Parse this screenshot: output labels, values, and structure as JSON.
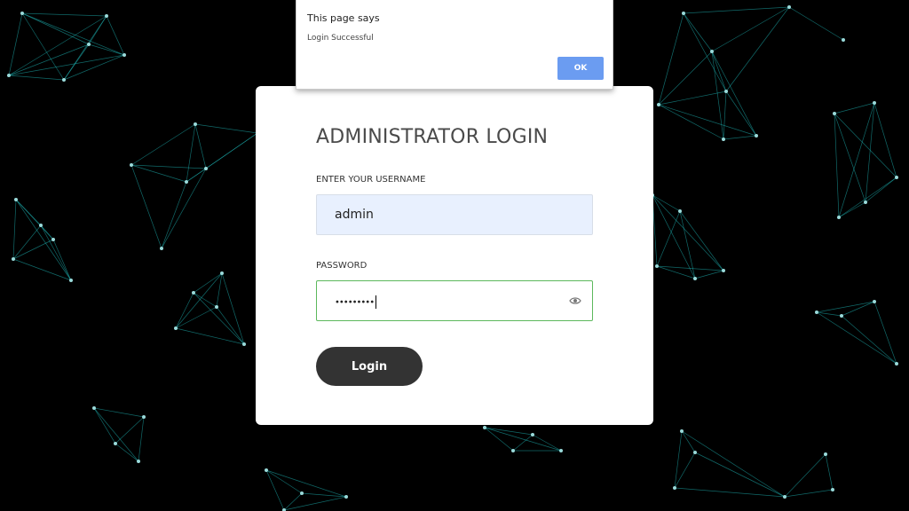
{
  "dialog": {
    "heading": "This page says",
    "message": "Login Successful",
    "ok_label": "OK"
  },
  "login": {
    "title": "ADMINISTRATOR LOGIN",
    "username_label": "ENTER YOUR USERNAME",
    "username_value": "admin",
    "password_label": "PASSWORD",
    "password_value": "•••••••••",
    "show_password_icon": "eye-icon",
    "submit_label": "Login"
  },
  "colors": {
    "background": "#000000",
    "network": "#1fbfbf",
    "card": "#ffffff",
    "username_fill": "#e8f0fe",
    "password_border": "#5cb85c",
    "login_button": "#333333",
    "ok_button": "#6b9cf1"
  }
}
